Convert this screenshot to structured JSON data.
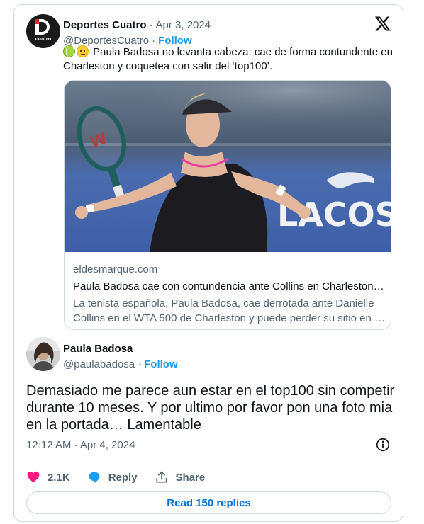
{
  "quoted": {
    "author_name": "Deportes Cuatro",
    "separator": "·",
    "date": "Apr 3, 2024",
    "handle": "@DeportesCuatro",
    "follow_label": "Follow",
    "avatar_text": "cuatro",
    "text": "Paula Badosa no levanta cabeza: cae de forma contundente en Charleston y coquetea con salir del ‘top100’.",
    "emojis": [
      "tennis-ball-emoji",
      "worried-face-emoji"
    ],
    "link_card": {
      "image_banner_text": "LACOSTE",
      "domain": "eldesmarque.com",
      "title": "Paula Badosa cae con contundencia ante Collins en Charleston y…",
      "description_line1": "La tenista española, Paula Badosa, cae derrotada ante Danielle",
      "description_line2": "Collins en el WTA 500 de Charleston y puede perder su sitio en …"
    }
  },
  "tweet": {
    "author_name": "Paula Badosa",
    "handle": "@paulabadosa",
    "separator": "·",
    "follow_label": "Follow",
    "text": "Demasiado me parece aun estar en el top100 sin competir durante 10 meses. Y por ultimo por favor pon una foto mia en la portada… Lamentable",
    "timestamp": "12:12 AM · Apr 4, 2024"
  },
  "actions": {
    "like_count": "2.1K",
    "reply_label": "Reply",
    "share_label": "Share",
    "read_replies_label": "Read 150 replies"
  },
  "colors": {
    "accent_blue": "#1d9bf0",
    "link_blue": "#006fd6",
    "like_pink": "#f91880",
    "text_primary": "#0f1419",
    "text_secondary": "#536471",
    "border": "#cfd9de"
  }
}
